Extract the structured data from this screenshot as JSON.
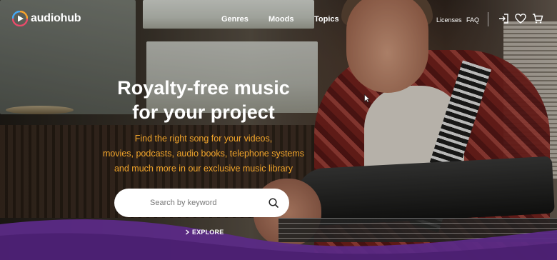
{
  "brand": {
    "name": "audiohub"
  },
  "nav": {
    "genres": "Genres",
    "moods": "Moods",
    "topics": "Topics",
    "licenses": "Licenses",
    "faq": "FAQ"
  },
  "icons": {
    "login": "login-icon",
    "favorites": "heart-icon",
    "cart": "cart-icon",
    "search": "search-icon",
    "explore": "chevron-right-icon"
  },
  "hero": {
    "headline_line1": "Royalty-free music",
    "headline_line2": "for your project",
    "tagline_line1": "Find the right song for your videos,",
    "tagline_line2": "movies, podcasts, audio books, telephone systems",
    "tagline_line3": "and much more in our exclusive music library"
  },
  "search": {
    "placeholder": "Search by keyword"
  },
  "explore": {
    "label": "EXPLORE"
  },
  "colors": {
    "accent": "#f2a52b",
    "wave_purple": "#5b2a86",
    "text_white": "#ffffff"
  }
}
